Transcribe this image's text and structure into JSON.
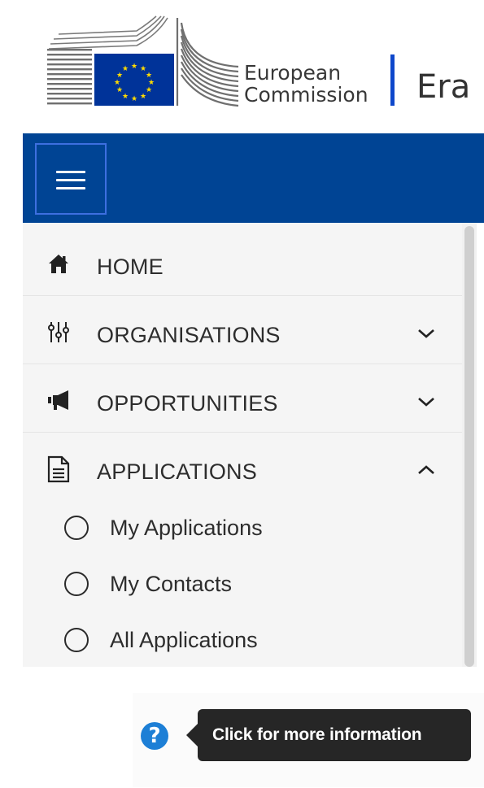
{
  "header": {
    "logo_line1": "European",
    "logo_line2": "Commission",
    "site_name": "Era",
    "brand_color": "#004494",
    "eu_flag_color": "#003399",
    "star_color": "#ffdd00"
  },
  "topbar": {
    "menu_icon": "hamburger-menu-icon"
  },
  "menu": {
    "items": [
      {
        "label": "HOME",
        "icon": "home-icon",
        "state": "none"
      },
      {
        "label": "ORGANISATIONS",
        "icon": "sliders-icon",
        "state": "collapsed"
      },
      {
        "label": "OPPORTUNITIES",
        "icon": "megaphone-icon",
        "state": "collapsed"
      },
      {
        "label": "APPLICATIONS",
        "icon": "document-icon",
        "state": "expanded"
      }
    ],
    "sub_items": [
      {
        "label": "My Applications"
      },
      {
        "label": "My Contacts"
      },
      {
        "label": "All Applications"
      }
    ]
  },
  "help": {
    "icon": "question-circle-icon",
    "glyph": "?",
    "tooltip": "Click for more information"
  }
}
